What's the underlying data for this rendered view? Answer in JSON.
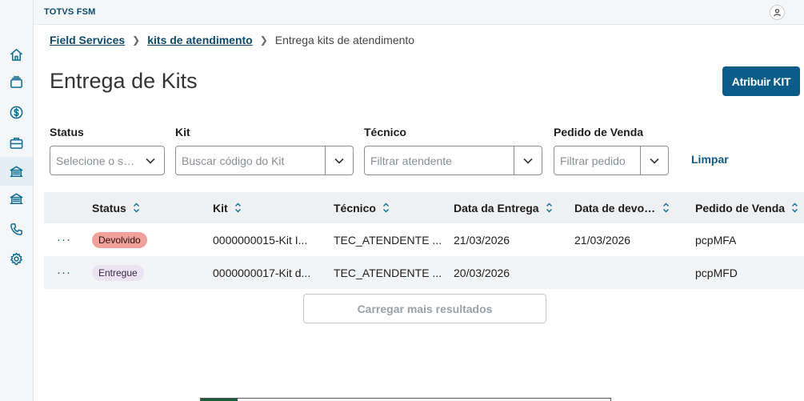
{
  "app": {
    "brand": "TOTVS FSM"
  },
  "breadcrumb": {
    "items": [
      "Field Services",
      "kits de atendimento"
    ],
    "current": "Entrega kits de atendimento"
  },
  "page": {
    "title": "Entrega de Kits",
    "primary_action": "Atribuir KIT"
  },
  "filters": {
    "status": {
      "label": "Status",
      "placeholder": "Selecione o status"
    },
    "kit": {
      "label": "Kit",
      "placeholder": "Buscar código do Kit"
    },
    "technician": {
      "label": "Técnico",
      "placeholder": "Filtrar atendente"
    },
    "order": {
      "label": "Pedido de Venda",
      "placeholder": "Filtrar pedido"
    },
    "clear_label": "Limpar"
  },
  "table": {
    "columns": [
      "Status",
      "Kit",
      "Técnico",
      "Data da Entrega",
      "Data de devolução",
      "Pedido de Venda"
    ],
    "rows": [
      {
        "actions": "···",
        "status": "Devolvido",
        "status_type": "returned",
        "kit": "0000000015-Kit I...",
        "technician": "TEC_ATENDENTE ...",
        "delivery_date": "21/03/2026",
        "return_date": "21/03/2026",
        "order": "pcpMFA"
      },
      {
        "actions": "···",
        "status": "Entregue",
        "status_type": "delivered",
        "kit": "0000000017-Kit d...",
        "technician": "TEC_ATENDENTE ...",
        "delivery_date": "20/03/2026",
        "return_date": "",
        "order": "pcpMFD"
      }
    ],
    "load_more_label": "Carregar mais resultados"
  },
  "colors": {
    "primary": "#0c5c8a",
    "brand": "#0c4a6e",
    "returned_badge": "#f0a19a",
    "delivered_badge": "#ece4f3"
  },
  "sidebar": {
    "icons": [
      "home-icon",
      "cards-icon",
      "dollar-icon",
      "briefcase-icon",
      "bank-icon",
      "bank-icon",
      "phone-icon",
      "gear-icon"
    ]
  }
}
